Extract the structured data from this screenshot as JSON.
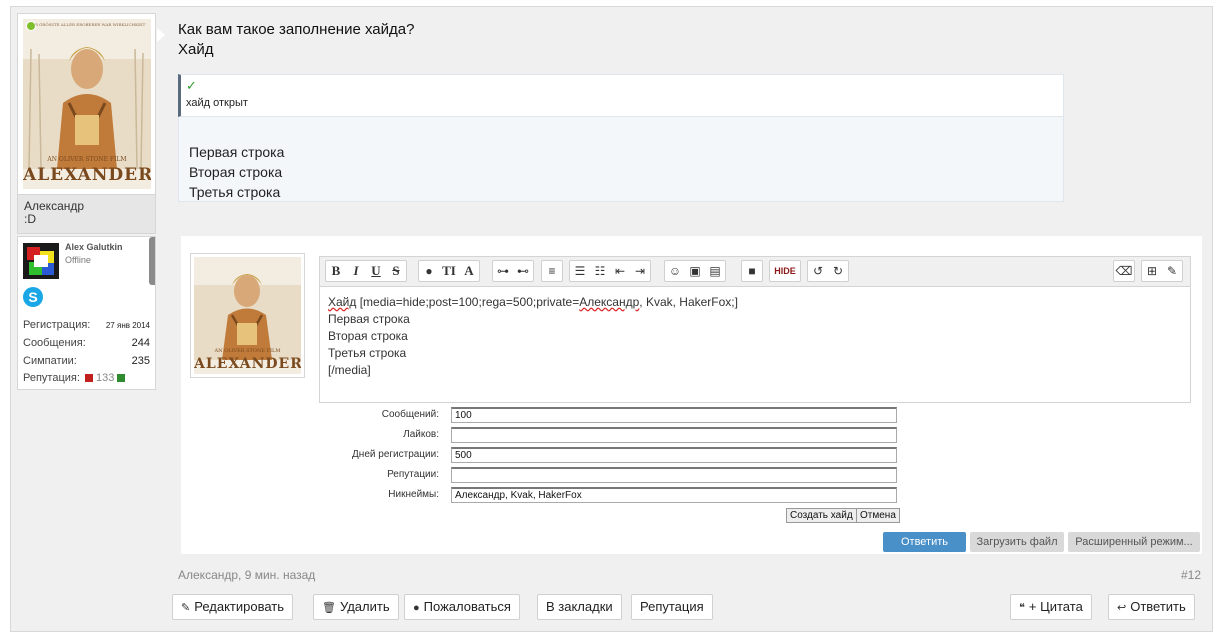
{
  "author": {
    "name": "Александр",
    "custom_title": ":D",
    "card": {
      "username": "Alex Galutkin",
      "status": "Offline",
      "skype_icon": "skype-icon",
      "stats": [
        {
          "label": "Регистрация:",
          "value": "27 янв 2014"
        },
        {
          "label": "Сообщения:",
          "value": "244"
        },
        {
          "label": "Симпатии:",
          "value": "235"
        },
        {
          "label": "Репутация:",
          "value": "133"
        }
      ]
    },
    "poster": {
      "title": "ALEXANDER",
      "director": "AN OLIVER STONE FILM",
      "tagline": "DER GRÖSSTE ALLER EROBERER WAR WIRKLICHKEIT"
    }
  },
  "message": {
    "line1": "Как вам такое заполнение хайда?",
    "line2": "Хайд",
    "hide": {
      "check": "✓",
      "label": "хайд открыт",
      "lines": [
        "Первая строка",
        "Вторая строка",
        "Третья строка"
      ]
    }
  },
  "editor": {
    "content": {
      "line1_prefix": "Хайд",
      "line1_rest": " [media=hide;post=100;rega=500;private=",
      "line1_underlined": "Александр",
      "line1_tail": ", Kvak, HakerFox;]",
      "line2": "Первая строка",
      "line3": "Вторая строка",
      "line4": "Третья строка",
      "line5": "[/media]"
    },
    "toolbar": {
      "hide_label": "HIDE"
    },
    "fields": [
      {
        "label": "Сообщений:",
        "value": "100"
      },
      {
        "label": "Лайков:",
        "value": ""
      },
      {
        "label": "Дней регистрации:",
        "value": "500"
      },
      {
        "label": "Репутации:",
        "value": ""
      },
      {
        "label": "Никнеймы:",
        "value": "Александр, Kvak, HakerFox"
      }
    ],
    "create_hide_label": "Создать хайд",
    "cancel_label": "Отмена",
    "reply_label": "Ответить",
    "upload_label": "Загрузить файл",
    "advanced_label": "Расширенный режим..."
  },
  "footer": {
    "meta": "Александр, 9 мин. назад",
    "post_number": "#12",
    "actions": {
      "edit": "Редактировать",
      "delete": "Удалить",
      "report": "Пожаловаться",
      "bookmark": "В закладки",
      "reputation": "Репутация",
      "quote": "+ Цитата",
      "reply": "Ответить"
    }
  },
  "colors": {
    "accent": "#4a90c8",
    "online": "#7fbf2b",
    "check": "#2f9a2f"
  }
}
